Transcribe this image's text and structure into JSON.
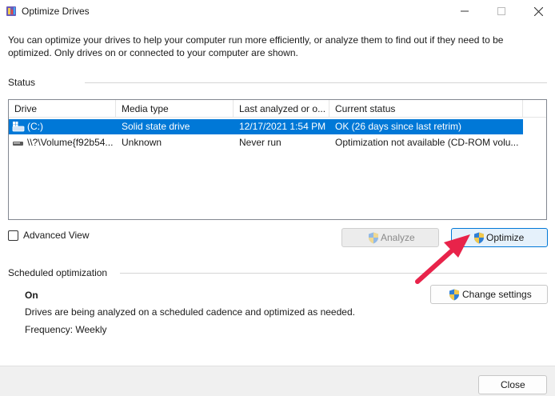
{
  "window": {
    "title": "Optimize Drives"
  },
  "intro_text": "You can optimize your drives to help your computer run more efficiently, or analyze them to find out if they need to be optimized. Only drives on or connected to your computer are shown.",
  "status": {
    "group_label": "Status",
    "columns": [
      "Drive",
      "Media type",
      "Last analyzed or o...",
      "Current status"
    ],
    "rows": [
      {
        "drive": "(C:)",
        "media_type": "Solid state drive",
        "last_analyzed": "12/17/2021 1:54 PM",
        "current_status": "OK (26 days since last retrim)",
        "selected": true
      },
      {
        "drive": "\\\\?\\Volume{f92b54...",
        "media_type": "Unknown",
        "last_analyzed": "Never run",
        "current_status": "Optimization not available (CD-ROM volu...",
        "selected": false
      }
    ]
  },
  "advanced_view_label": "Advanced View",
  "analyze_label": "Analyze",
  "optimize_label": "Optimize",
  "scheduled": {
    "group_label": "Scheduled optimization",
    "state": "On",
    "description": "Drives are being analyzed on a scheduled cadence and optimized as needed.",
    "frequency": "Frequency: Weekly",
    "change_settings_label": "Change settings"
  },
  "close_label": "Close",
  "colors": {
    "selection": "#0078d7",
    "annotation_arrow": "#e8234a"
  }
}
